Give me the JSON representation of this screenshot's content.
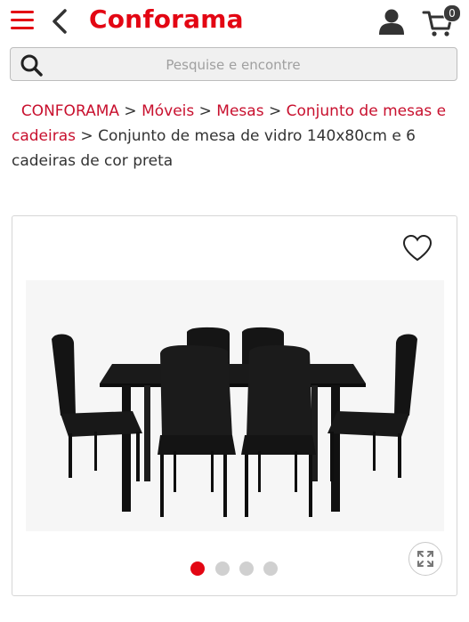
{
  "header": {
    "logo": "Conforama",
    "cart_count": "0"
  },
  "search": {
    "placeholder": "Pesquise e encontre"
  },
  "breadcrumb": {
    "items": [
      "CONFORAMA",
      "Móveis",
      "Mesas",
      "Conjunto de mesas e cadeiras"
    ],
    "separator": ">",
    "current": "Conjunto de mesa de vidro 140x80cm e 6 cadeiras de cor preta"
  },
  "gallery": {
    "image_count": 4,
    "active_index": 0
  },
  "colors": {
    "brand": "#e30613",
    "link": "#c8102e",
    "dot_active": "#e30613",
    "dot_inactive": "#d0d0d0"
  },
  "icons": [
    "menu-icon",
    "chevron-left-icon",
    "user-icon",
    "cart-icon",
    "search-icon",
    "heart-icon",
    "expand-icon"
  ]
}
